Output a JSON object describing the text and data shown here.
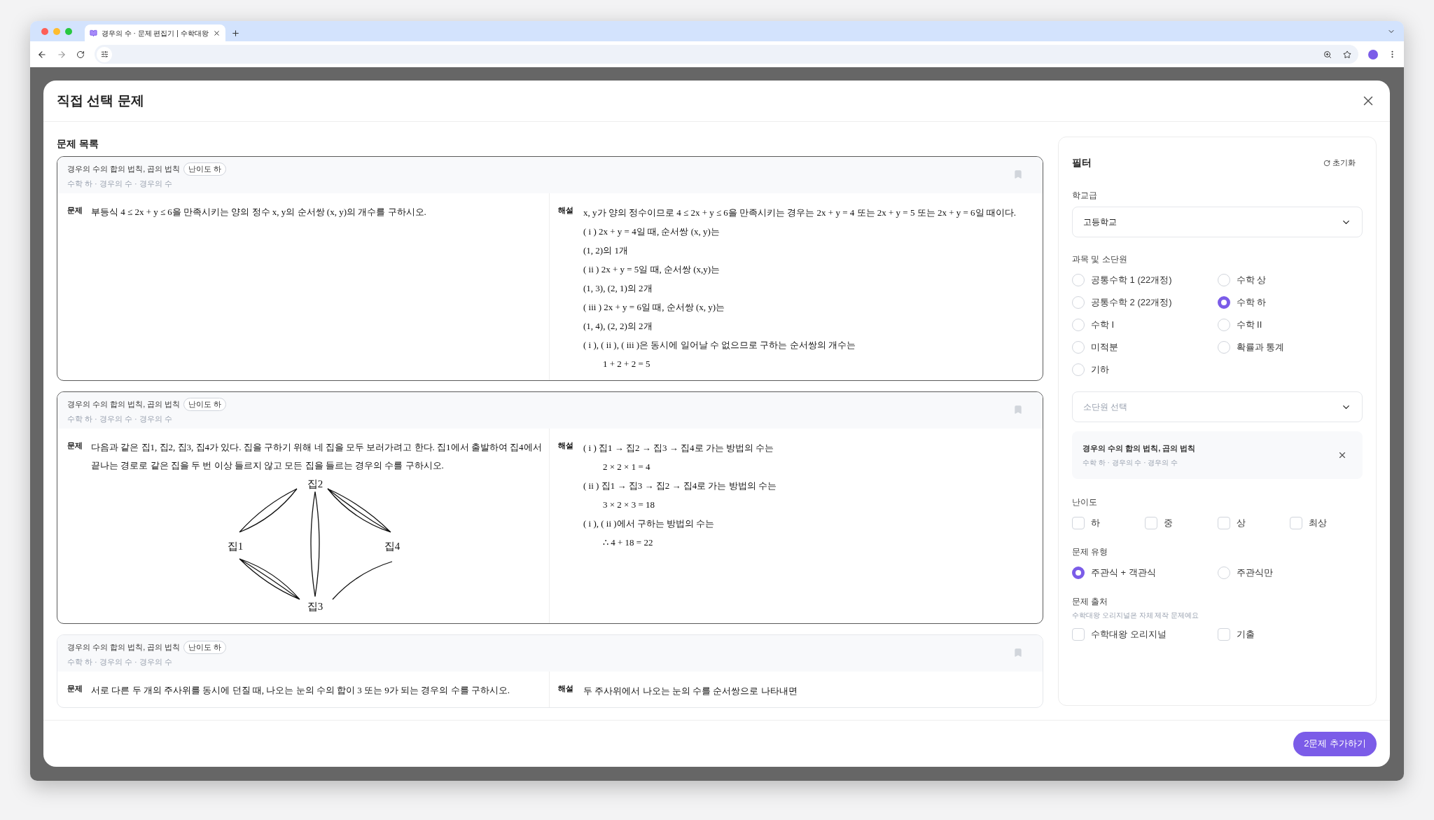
{
  "browser": {
    "tab_title": "경우의 수 · 문제 편집기 | 수학대왕"
  },
  "modal": {
    "title": "직접 선택 문제",
    "list_title": "문제 목록",
    "problems": [
      {
        "selected": true,
        "title": "경우의 수의 합의 법칙, 곱의 법칙",
        "difficulty": "난이도 하",
        "path": "수학 하 · 경우의 수 · 경우의 수",
        "problem_label": "문제",
        "problem": "부등식 4 ≤ 2x + y ≤ 6을 만족시키는 양의 정수 x, y의 순서쌍 (x, y)의 개수를 구하시오.",
        "solution_label": "해설",
        "solution": [
          {
            "text": "x, y가 양의 정수이므로 4 ≤ 2x + y ≤ 6을 만족시키는 경우는 2x + y = 4 또는 2x + y = 5 또는 2x + y = 6일 때이다.",
            "indented": false
          },
          {
            "text": "( i ) 2x + y = 4일 때, 순서쌍 (x, y)는",
            "indented": false
          },
          {
            "text": "(1, 2)의 1개",
            "indented": false
          },
          {
            "text": "( ii ) 2x + y = 5일 때, 순서쌍 (x,y)는",
            "indented": false
          },
          {
            "text": "(1, 3), (2, 1)의 2개",
            "indented": false
          },
          {
            "text": "( iii ) 2x + y = 6일 때, 순서쌍 (x, y)는",
            "indented": false
          },
          {
            "text": "(1, 4), (2, 2)의 2개",
            "indented": false
          },
          {
            "text": "( i ), ( ii ), ( iii )은 동시에 일어날 수 없으므로 구하는 순서쌍의 개수는",
            "indented": false
          },
          {
            "text": "1 + 2 + 2 = 5",
            "indented": true
          }
        ]
      },
      {
        "selected": true,
        "title": "경우의 수의 합의 법칙, 곱의 법칙",
        "difficulty": "난이도 하",
        "path": "수학 하 · 경우의 수 · 경우의 수",
        "problem_label": "문제",
        "problem": "다음과 같은 집1, 집2, 집3, 집4가 있다. 집을 구하기 위해 네 집을 모두 보러가려고 한다. 집1에서 출발하여 집4에서 끝나는 경로로 같은 집을 두 번 이상 들르지 않고 모든 집을 들르는 경우의 수를 구하시오.",
        "diagram": {
          "labels": [
            "집2",
            "집1",
            "집4",
            "집3"
          ]
        },
        "solution_label": "해설",
        "solution": [
          {
            "text": "( i ) 집1 → 집2 → 집3 → 집4로 가는 방법의 수는",
            "indented": false
          },
          {
            "text": "2 × 2 × 1 = 4",
            "indented": true
          },
          {
            "text": "( ii ) 집1 → 집3 → 집2 → 집4로 가는 방법의 수는",
            "indented": false
          },
          {
            "text": "3 × 2 × 3 = 18",
            "indented": true
          },
          {
            "text": "( i ), ( ii )에서 구하는 방법의 수는",
            "indented": false
          },
          {
            "text": "∴ 4 + 18 = 22",
            "indented": true
          }
        ]
      },
      {
        "selected": false,
        "title": "경우의 수의 합의 법칙, 곱의 법칙",
        "difficulty": "난이도 하",
        "path": "수학 하 · 경우의 수 · 경우의 수",
        "problem_label": "문제",
        "problem": "서로 다른 두 개의 주사위를 동시에 던질 때, 나오는 눈의 수의 합이 3 또는 9가 되는 경우의 수를 구하시오.",
        "solution_label": "해설",
        "solution": [
          {
            "text": "두 주사위에서 나오는 눈의 수를 순서쌍으로 나타내면",
            "indented": false
          }
        ]
      }
    ],
    "filter": {
      "title": "필터",
      "reset": "초기화",
      "school_label": "학교급",
      "school_value": "고등학교",
      "subject_label": "과목 및 소단원",
      "subjects": [
        {
          "label": "공통수학 1 (22개정)",
          "selected": false
        },
        {
          "label": "수학 상",
          "selected": false
        },
        {
          "label": "공통수학 2 (22개정)",
          "selected": false
        },
        {
          "label": "수학 하",
          "selected": true
        },
        {
          "label": "수학 I",
          "selected": false
        },
        {
          "label": "수학 II",
          "selected": false
        },
        {
          "label": "미적분",
          "selected": false
        },
        {
          "label": "확률과 통계",
          "selected": false
        },
        {
          "label": "기하",
          "selected": false
        }
      ],
      "unit_placeholder": "소단원 선택",
      "chosen_unit": {
        "title": "경우의 수의 합의 법칙, 곱의 법칙",
        "path": "수학 하 · 경우의 수 · 경우의 수"
      },
      "difficulty_label": "난이도",
      "difficulties": [
        {
          "label": "하",
          "checked": false
        },
        {
          "label": "중",
          "checked": false
        },
        {
          "label": "상",
          "checked": false
        },
        {
          "label": "최상",
          "checked": false
        }
      ],
      "type_label": "문제 유형",
      "types": [
        {
          "label": "주관식 + 객관식",
          "selected": true
        },
        {
          "label": "주관식만",
          "selected": false
        }
      ],
      "source_label": "문제 출처",
      "source_hint": "수학대왕 오리지널은 자체 제작 문제예요",
      "sources": [
        {
          "label": "수학대왕 오리지널",
          "checked": false
        },
        {
          "label": "기출",
          "checked": false
        }
      ]
    },
    "add_button": "2문제 추가하기"
  }
}
